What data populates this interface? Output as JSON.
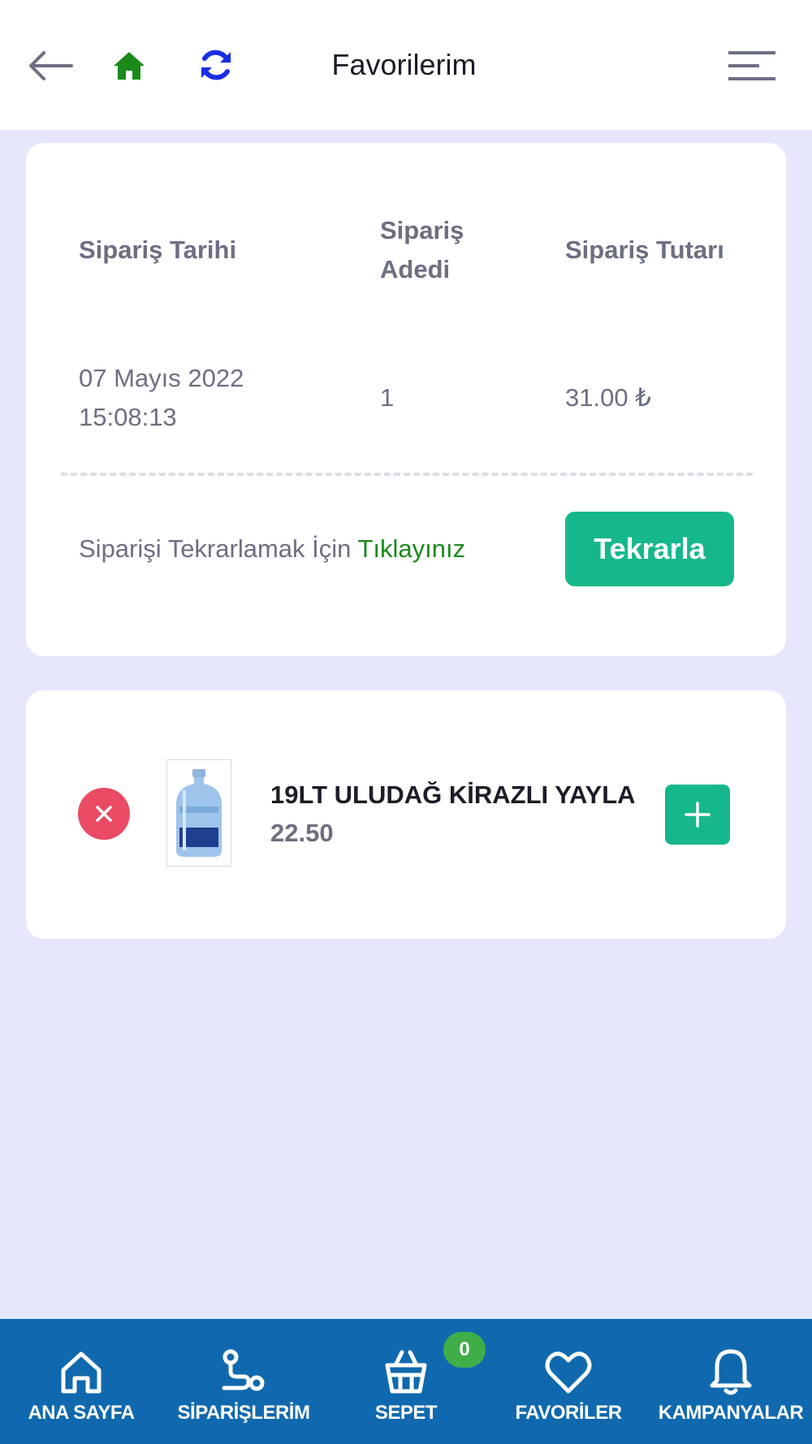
{
  "header": {
    "title": "Favorilerim",
    "icons": {
      "back": "arrow-left-icon",
      "home": "home-icon",
      "refresh": "refresh-icon",
      "menu": "menu-icon"
    },
    "colors": {
      "home": "#1a8a1a",
      "refresh": "#1a2ee6"
    }
  },
  "order": {
    "columns": {
      "date": "Sipariş Tarihi",
      "qty": "Sipariş Adedi",
      "total": "Sipariş Tutarı"
    },
    "row": {
      "date": "07 Mayıs 2022 15:08:13",
      "qty": "1",
      "total": "31.00 ₺"
    },
    "repeat_text": "Siparişi Tekrarlamak İçin",
    "repeat_link": "Tıklayınız",
    "repeat_button": "Tekrarla"
  },
  "favorite": {
    "product_name": "19LT ULUDAĞ KİRAZLI YAYLA",
    "price": "22.50"
  },
  "bottom_nav": {
    "items": [
      {
        "label": "ANA SAYFA",
        "icon": "home-outline-icon"
      },
      {
        "label": "SİPARİŞLERİM",
        "icon": "route-icon"
      },
      {
        "label": "SEPET",
        "icon": "basket-icon"
      },
      {
        "label": "FAVORİLER",
        "icon": "heart-icon"
      },
      {
        "label": "KAMPANYALAR",
        "icon": "bell-icon"
      }
    ],
    "cart_count": "0"
  },
  "colors": {
    "accent": "#16b88b",
    "danger": "#ea4a63",
    "nav_bg": "#1069ae",
    "page_bg": "#e6e7fc",
    "badge": "#3fae49"
  }
}
